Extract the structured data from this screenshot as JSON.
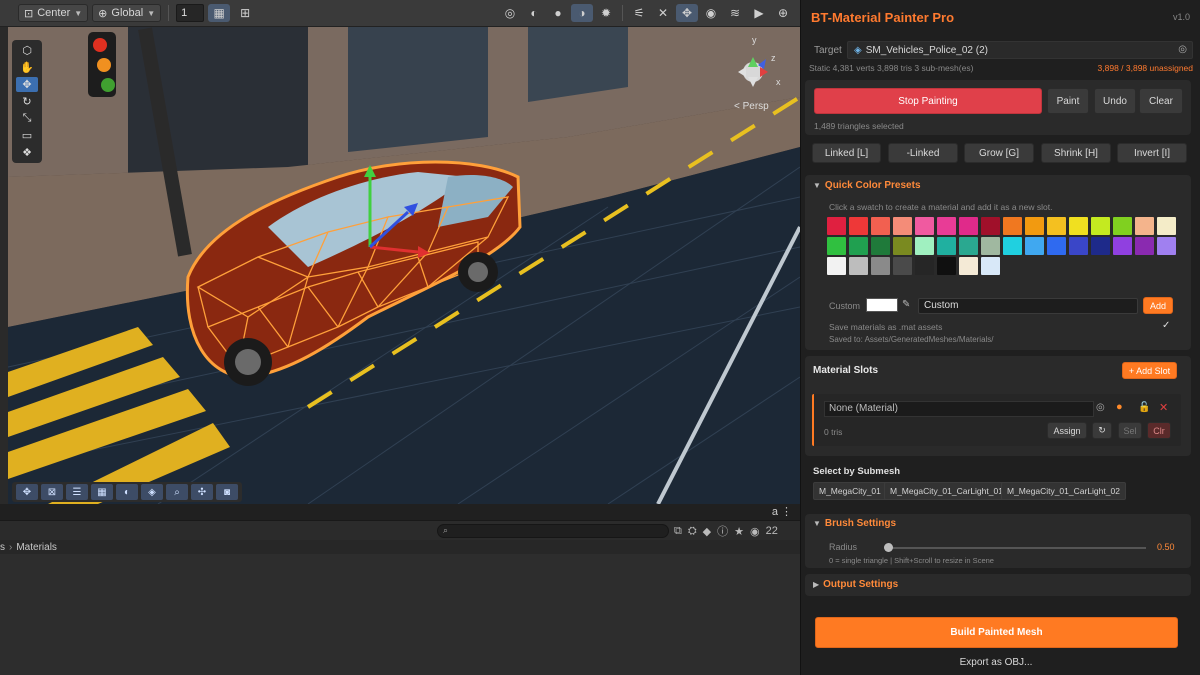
{
  "scene_toolbar": {
    "pivot": "Center",
    "space": "Global",
    "snap_value": "1"
  },
  "viewport": {
    "camera_mode": "< Persp",
    "gizmo_axes": {
      "x": "x",
      "y": "y",
      "z": "z"
    }
  },
  "project": {
    "breadcrumb": [
      "s",
      "Materials"
    ],
    "count": "22"
  },
  "panel": {
    "title": "BT-Material Painter Pro",
    "version": "v1.0",
    "target_label": "Target",
    "target_value": "SM_Vehicles_Police_02 (2)",
    "stats": "Static 4,381 verts 3,898 tris 3 sub-mesh(es)",
    "unassigned": "3,898 / 3,898 unassigned",
    "stop_painting": "Stop Painting",
    "paint": "Paint",
    "undo": "Undo",
    "clear": "Clear",
    "selected_info": "1,489 triangles selected",
    "selection_buttons": [
      "Linked [L]",
      "-Linked",
      "Grow [G]",
      "Shrink [H]",
      "Invert [I]"
    ],
    "quick_presets": {
      "title": "Quick Color Presets",
      "hint": "Click a swatch to create a material and add it as a new slot.",
      "swatches": [
        "#e02040",
        "#ee3838",
        "#f26050",
        "#f48c78",
        "#f05aa0",
        "#e83c96",
        "#e02a8a",
        "#a0102a",
        "#f07820",
        "#f29a10",
        "#f4c020",
        "#f0e020",
        "#c4ea20",
        "#80d020",
        "#f4b48c",
        "#f4ecc8",
        "#30c040",
        "#20a050",
        "#1f7a3a",
        "#7a8a20",
        "#a0f0c0",
        "#20b0a0",
        "#2aa890",
        "#a0b8a0",
        "#20d0e0",
        "#40a8f0",
        "#2f6af0",
        "#3a46c8",
        "#1e2a8a",
        "#9040e0",
        "#8a2ab0",
        "#a080f0",
        "#f2f2f2",
        "#bdbdbd",
        "#8a8a8a",
        "#4a4a4a",
        "#262626",
        "#101010",
        "#f4ead6",
        "#d8e8f8"
      ],
      "custom_label": "Custom",
      "custom_name": "Custom",
      "add": "Add",
      "save_label": "Save materials as .mat assets",
      "save_checked": "✓",
      "saved_to": "Saved to: Assets/GeneratedMeshes/Materials/"
    },
    "material_slots": {
      "title": "Material Slots",
      "add_slot": "+ Add Slot",
      "slot_value": "None (Material)",
      "tris": "0 tris",
      "assign": "Assign",
      "sel": "Sel",
      "clr": "Clr"
    },
    "submesh": {
      "title": "Select by Submesh",
      "items": [
        "M_MegaCity_01",
        "M_MegaCity_01_CarLight_01",
        "M_MegaCity_01_CarLight_02"
      ]
    },
    "brush": {
      "title": "Brush Settings",
      "radius_label": "Radius",
      "radius_value": "0.50",
      "radius_fraction": 0.0,
      "hint": "0 = single triangle | Shift+Scroll to resize in Scene"
    },
    "output": {
      "title": "Output Settings"
    },
    "build": "Build Painted Mesh",
    "export": "Export as OBJ..."
  }
}
